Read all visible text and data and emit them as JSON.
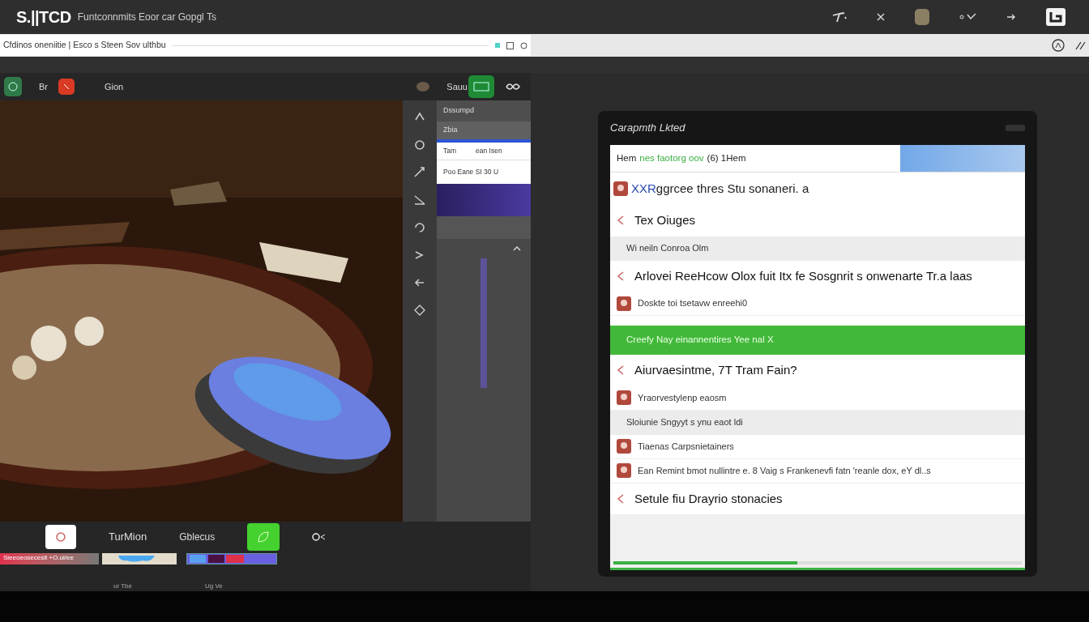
{
  "window": {
    "logo": "S.||TCD",
    "title": "Funtconnmits Eoor car Gopgl Ts"
  },
  "address_bar": {
    "text": "Cfdinos oneniitie | Esco s Steen Sov ulthbu"
  },
  "toolbar": {
    "labels": [
      "Br",
      "Gion",
      "Sauu"
    ]
  },
  "side_panel": {
    "items": [
      {
        "label": "Dssumpd",
        "selected": false
      },
      {
        "label": "Zbia",
        "selected": true
      }
    ],
    "popup": [
      "Tam",
      "ean Isen",
      "Poo Eane SI 30 U"
    ]
  },
  "player_bar": {
    "labels": [
      "TurMion",
      "Gblecus"
    ],
    "caption": "Sieeoeosecesit +O.ul/ee",
    "sub_labels": [
      "ur Tbe",
      "Ug Ve"
    ]
  },
  "dialog": {
    "title": "Carapmth Lkted",
    "rows": [
      {
        "kind": "header",
        "segments": [
          {
            "text": "Hem",
            "accent": false
          },
          {
            "text": "nes faotorg oov",
            "accent": true
          },
          {
            "text": "(6) 1Hem",
            "accent": false
          }
        ]
      },
      {
        "kind": "title",
        "prefix": "XXR",
        "text": "ggrcee thres Stu sonaneri. a"
      },
      {
        "kind": "large",
        "text": "Tex Oiuges"
      },
      {
        "kind": "section",
        "text": "Wi neiln Conroa Olm"
      },
      {
        "kind": "large",
        "text": "Arlovei ReeHcow Olox fuit Itx fe Sosgnrit s onwenarte Tr.a laas"
      },
      {
        "kind": "item",
        "text": "Doskte toi tsetavw enreehi0"
      },
      {
        "kind": "green",
        "text": "Creefy Nay einannentires Yee nal X"
      },
      {
        "kind": "large",
        "text": "Aiurvaesintme,      7T Tram Fain?"
      },
      {
        "kind": "item",
        "text": "Yraorvestylenp eaosm"
      },
      {
        "kind": "section",
        "text": "Sloiunie Sngyyt s ynu eaot ldi"
      },
      {
        "kind": "item",
        "text": "Tiaenas Carpsnietainers"
      },
      {
        "kind": "item",
        "text": "Ean Remint bmot nullintre e. 8 Vaig s Frankenevfi fatn 'reanle dox, eY dl..s"
      },
      {
        "kind": "large",
        "text": "Setule fiu Drayrio stonacies"
      },
      {
        "kind": "footer",
        "level": 0.45
      }
    ]
  }
}
